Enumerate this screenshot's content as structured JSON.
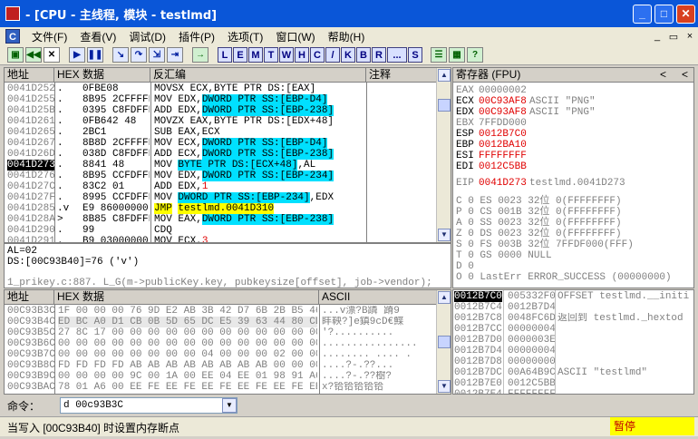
{
  "window": {
    "title": "- [CPU - 主线程, 模块 - testlmd]"
  },
  "menu": [
    "文件(F)",
    "查看(V)",
    "调试(D)",
    "插件(P)",
    "选项(T)",
    "窗口(W)",
    "帮助(H)"
  ],
  "mdi": [
    "_",
    "▭",
    "×"
  ],
  "toolbar": {
    "letters": [
      "L",
      "E",
      "M",
      "T",
      "W",
      "H",
      "C",
      "/",
      "K",
      "B",
      "R",
      "...",
      "S"
    ]
  },
  "disasm": {
    "headers": [
      "地址",
      "HEX 数据",
      "反汇编",
      "注释"
    ],
    "rows": [
      {
        "addr": "0041D252",
        "m": ".",
        "hex": "0FBE08",
        "asm": "MOVSX ECX,BYTE PTR DS:[EAX]",
        "s": "n"
      },
      {
        "addr": "0041D255",
        "m": ".",
        "hex": "8B95 2CFFFFFF",
        "asm": "MOV EDX,",
        "op": "DWORD PTR SS:[EBP-D4]",
        "s": "n"
      },
      {
        "addr": "0041D25B",
        "m": ".",
        "hex": "0395 C8FDFFFF",
        "asm": "ADD EDX,",
        "op": "DWORD PTR SS:[EBP-238]",
        "s": "n"
      },
      {
        "addr": "0041D261",
        "m": ".",
        "hex": "0FB642 48",
        "asm": "MOVZX EAX,BYTE PTR DS:[EDX+48]",
        "s": "n"
      },
      {
        "addr": "0041D265",
        "m": ".",
        "hex": "2BC1",
        "asm": "SUB EAX,ECX",
        "s": "n"
      },
      {
        "addr": "0041D267",
        "m": ".",
        "hex": "8B8D 2CFFFFFF",
        "asm": "MOV ECX,",
        "op": "DWORD PTR SS:[EBP-D4]",
        "s": "n"
      },
      {
        "addr": "0041D26D",
        "m": ".",
        "hex": "038D C8FDFFFF",
        "asm": "ADD ECX,",
        "op": "DWORD PTR SS:[EBP-238]",
        "s": "n"
      },
      {
        "addr": "0041D273",
        "m": ".",
        "hex": "8841 48",
        "asm": "MOV ",
        "op": "BYTE PTR DS:[ECX+48]",
        "tail": ",AL",
        "s": "sel"
      },
      {
        "addr": "0041D276",
        "m": ".",
        "hex": "8B95 CCFDFFFF",
        "asm": "MOV EDX,",
        "op": "DWORD PTR SS:[EBP-234]",
        "s": "n"
      },
      {
        "addr": "0041D27C",
        "m": ".",
        "hex": "83C2 01",
        "asm": "ADD EDX,",
        "red": "1",
        "s": "n"
      },
      {
        "addr": "0041D27F",
        "m": ".",
        "hex": "8995 CCFDFFFF",
        "asm": "MOV ",
        "op": "DWORD PTR SS:[EBP-234]",
        "tail": ",EDX",
        "s": "n"
      },
      {
        "addr": "0041D285",
        "m": ".v",
        "hex": "E9 86000000",
        "asm": "JMP",
        "jmp": "testlmd.0041D310",
        "s": "n"
      },
      {
        "addr": "0041D28A",
        "m": ">",
        "hex": "8B85 C8FDFFFF",
        "asm": "MOV EAX,",
        "op": "DWORD PTR SS:[EBP-238]",
        "s": "n"
      },
      {
        "addr": "0041D290",
        "m": ".",
        "hex": "99",
        "asm": "CDQ",
        "s": "n"
      },
      {
        "addr": "0041D291",
        "m": ".",
        "hex": "B9 03000000",
        "asm": "MOV ECX,",
        "red": "3",
        "s": "n"
      }
    ]
  },
  "registers": {
    "header": "寄存器 (FPU)",
    "gp": [
      {
        "n": "EAX",
        "v": "00000002",
        "c": "",
        "g": true
      },
      {
        "n": "ECX",
        "v": "00C93AF8",
        "c": "ASCII \"PNG\"",
        "g": false
      },
      {
        "n": "EDX",
        "v": "00C93AF8",
        "c": "ASCII \"PNG\"",
        "g": false
      },
      {
        "n": "EBX",
        "v": "7FFDD000",
        "c": "",
        "g": true
      },
      {
        "n": "ESP",
        "v": "0012B7C0",
        "c": "",
        "g": false
      },
      {
        "n": "EBP",
        "v": "0012BA10",
        "c": "",
        "g": false
      },
      {
        "n": "ESI",
        "v": "FFFFFFFF",
        "c": "",
        "g": false
      },
      {
        "n": "EDI",
        "v": "0012C5BB",
        "c": "",
        "g": false
      }
    ],
    "eip": {
      "n": "EIP",
      "v": "0041D273",
      "c": "testlmd.0041D273"
    },
    "flags": [
      "C 0   ES 0023 32位 0(FFFFFFFF)",
      "P 0   CS 001B 32位 0(FFFFFFFF)",
      "A 0   SS 0023 32位 0(FFFFFFFF)",
      "Z 0   DS 0023 32位 0(FFFFFFFF)",
      "S 0   FS 003B 32位 7FFDF000(FFF)",
      "T 0   GS 0000 NULL",
      "D 0",
      "O 0   LastErr ERROR_SUCCESS (00000000)"
    ]
  },
  "info": {
    "l1": "AL=02",
    "l2": "DS:[00C93B40]=76 ('v')",
    "l3": "1_prikey.c:887.   L_G(m->publicKey.key, pubkeysize[offset], job->vendor);"
  },
  "dump": {
    "headers": [
      "地址",
      "HEX 数据",
      "ASCII"
    ],
    "rows": [
      {
        "a": "00C93B3C",
        "h": "1F 00 00 00 76 9D E2 AB 3B 42 D7 6B 2B B5 46 39",
        "x": "...v漂?B蹸 蹐9"
      },
      {
        "a": "00C93B4C",
        "h": "ED BC A0 D1 CB 0B 5D 65 DC E5 39 63 44 80 CD 78",
        "x": "盽鞅?]e鎮9cD€鰈"
      },
      {
        "a": "00C93B5C",
        "h": "27 8C 17 00 00 00 00 00 00 00 00 00 00 00 00 00",
        "x": "'?.........."
      },
      {
        "a": "00C93B6C",
        "h": "00 00 00 00 00 00 00 00 00 00 00 00 00 00 00 00",
        "x": "................"
      },
      {
        "a": "00C93B7C",
        "h": "00 00 00 00 00 00 00 00 04 00 00 00 02 00 00 00",
        "x": "........ .... ."
      },
      {
        "a": "00C93B8C",
        "h": "FD FD FD FD AB AB AB AB AB AB AB AB 00 00 00 00",
        "x": "....?-.??..."
      },
      {
        "a": "00C93B9C",
        "h": "00 00 00 00 9C 00 1A 00 EE 04 EE 01 98 91 A6 00",
        "x": "....?-.??樹?"
      },
      {
        "a": "00C93BAC",
        "h": "78 01 A6 00 EE FE EE FE EE FE EE FE EE FE EE FE",
        "x": "x?铪铪铪铪铪"
      }
    ]
  },
  "stack": {
    "rows": [
      {
        "a": "0012B7C0",
        "v": "005332F0",
        "c": "OFFSET testlmd.__initi"
      },
      {
        "a": "0012B7C4",
        "v": "0012B7D4",
        "c": ""
      },
      {
        "a": "0012B7C8",
        "v": "0048FC6D",
        "c": "返回到 testlmd._hextod"
      },
      {
        "a": "0012B7CC",
        "v": "00000004",
        "c": ""
      },
      {
        "a": "0012B7D0",
        "v": "0000003E",
        "c": ""
      },
      {
        "a": "0012B7D4",
        "v": "00000004",
        "c": ""
      },
      {
        "a": "0012B7D8",
        "v": "00000000",
        "c": ""
      },
      {
        "a": "0012B7DC",
        "v": "00A64B9C",
        "c": "ASCII \"testlmd\""
      },
      {
        "a": "0012B7E0",
        "v": "0012C5BB",
        "c": ""
      },
      {
        "a": "0012B7E4",
        "v": "FFFFFFFF",
        "c": ""
      }
    ]
  },
  "command": {
    "label": "命令：",
    "value": "d 00c93B3C"
  },
  "status": {
    "text": "当写入 [00C93B40] 时设置内存断点",
    "state": "暂停"
  }
}
